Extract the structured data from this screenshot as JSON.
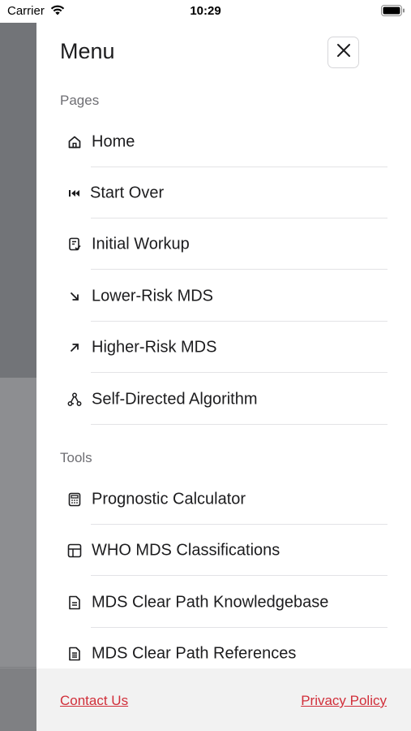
{
  "status_bar": {
    "carrier": "Carrier",
    "time": "10:29"
  },
  "menu": {
    "title": "Menu",
    "sections": [
      {
        "label": "Pages",
        "items": [
          {
            "label": "Home",
            "icon": "home-icon"
          },
          {
            "label": "Start Over",
            "icon": "rewind-icon"
          },
          {
            "label": "Initial Workup",
            "icon": "clipboard-check-icon"
          },
          {
            "label": "Lower-Risk MDS",
            "icon": "arrow-down-right-icon"
          },
          {
            "label": "Higher-Risk MDS",
            "icon": "arrow-up-right-icon"
          },
          {
            "label": "Self-Directed Algorithm",
            "icon": "network-nodes-icon"
          }
        ]
      },
      {
        "label": "Tools",
        "items": [
          {
            "label": "Prognostic Calculator",
            "icon": "calculator-icon"
          },
          {
            "label": "WHO MDS Classifications",
            "icon": "table-grid-icon"
          },
          {
            "label": "MDS Clear Path Knowledgebase",
            "icon": "document-icon"
          },
          {
            "label": "MDS Clear Path References",
            "icon": "document-lines-icon"
          }
        ]
      }
    ]
  },
  "footer": {
    "contact": "Contact Us",
    "privacy": "Privacy Policy"
  },
  "colors": {
    "accent_link": "#d12f3a",
    "text": "#1c1c1e",
    "muted": "#6e6e73",
    "overlay": "#727478"
  }
}
